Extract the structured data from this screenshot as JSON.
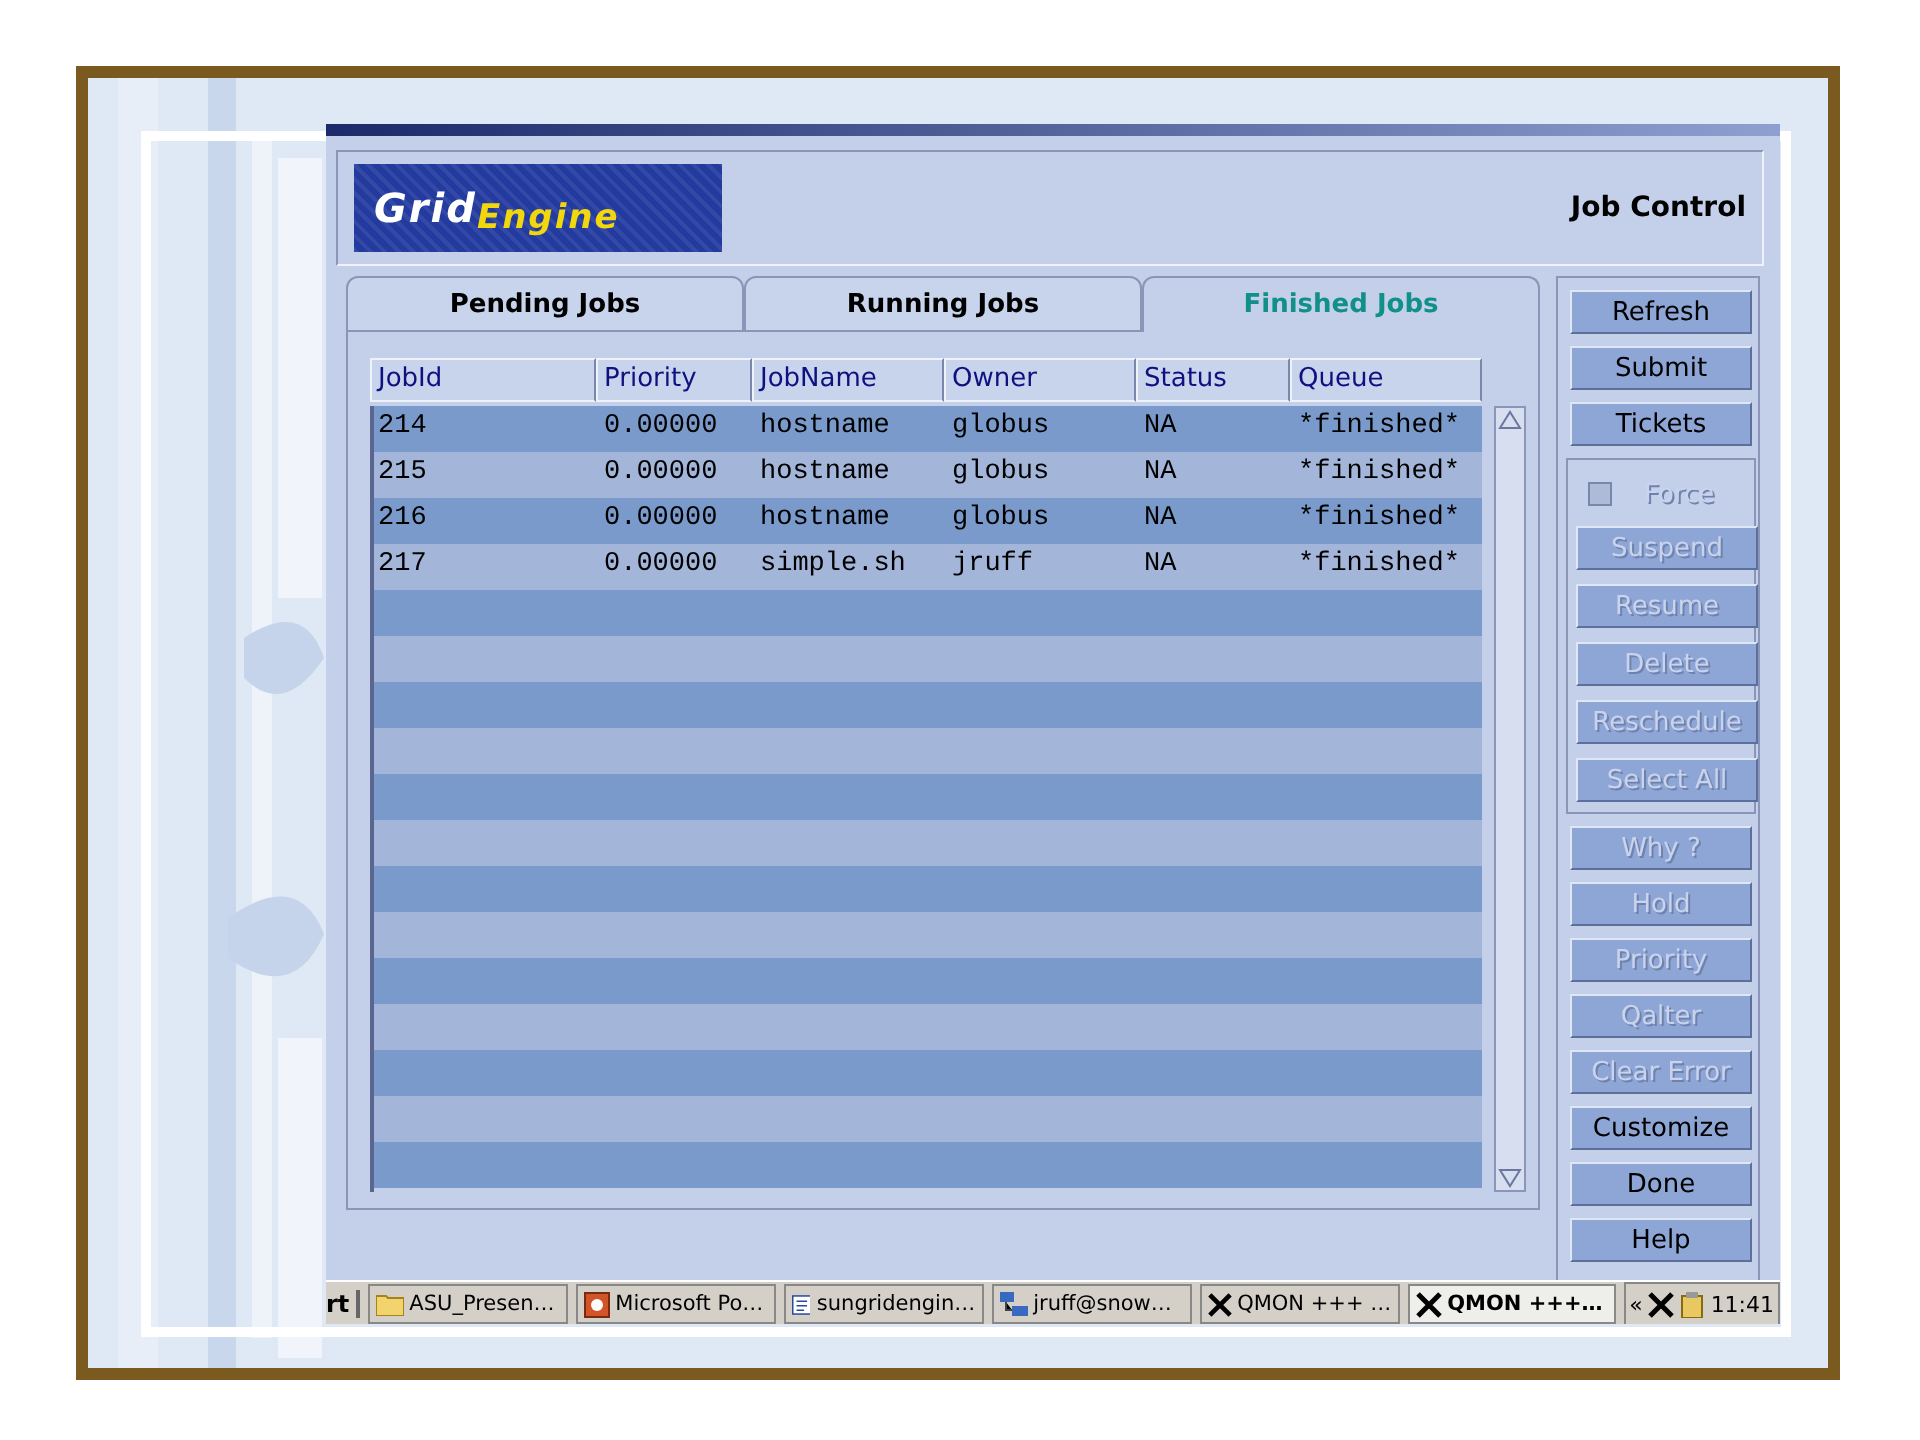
{
  "logo": {
    "first": "Grid",
    "second": "Engine"
  },
  "header_title": "Job Control",
  "tabs": [
    {
      "label": "Pending Jobs",
      "selected": false
    },
    {
      "label": "Running Jobs",
      "selected": false
    },
    {
      "label": "Finished Jobs",
      "selected": true
    }
  ],
  "table": {
    "columns": [
      "JobId",
      "Priority",
      "JobName",
      "Owner",
      "Status",
      "Queue"
    ],
    "rows": [
      [
        "214",
        "0.00000",
        "hostname",
        "globus",
        "NA",
        "*finished*"
      ],
      [
        "215",
        "0.00000",
        "hostname",
        "globus",
        "NA",
        "*finished*"
      ],
      [
        "216",
        "0.00000",
        "hostname",
        "globus",
        "NA",
        "*finished*"
      ],
      [
        "217",
        "0.00000",
        "simple.sh",
        "jruff",
        "NA",
        "*finished*"
      ]
    ]
  },
  "buttons_top": [
    {
      "label": "Refresh",
      "disabled": false
    },
    {
      "label": "Submit",
      "disabled": false
    },
    {
      "label": "Tickets",
      "disabled": false
    }
  ],
  "job_group": {
    "force": {
      "label": "Force",
      "checked": false,
      "disabled": true
    },
    "buttons": [
      {
        "label": "Suspend",
        "disabled": true
      },
      {
        "label": "Resume",
        "disabled": true
      },
      {
        "label": "Delete",
        "disabled": true
      },
      {
        "label": "Reschedule",
        "disabled": true
      },
      {
        "label": "Select All",
        "disabled": true
      }
    ]
  },
  "buttons_bottom": [
    {
      "label": "Why ?",
      "disabled": true
    },
    {
      "label": "Hold",
      "disabled": true
    },
    {
      "label": "Priority",
      "disabled": true
    },
    {
      "label": "Qalter",
      "disabled": true
    },
    {
      "label": "Clear Error",
      "disabled": true
    },
    {
      "label": "Customize",
      "disabled": false
    },
    {
      "label": "Done",
      "disabled": false
    },
    {
      "label": "Help",
      "disabled": false
    }
  ],
  "taskbar": {
    "start": "rt",
    "items": [
      {
        "label": "ASU_Presen…",
        "kind": "folder",
        "selected": false
      },
      {
        "label": "Microsoft Po…",
        "kind": "slides",
        "selected": false
      },
      {
        "label": "sungridengin…",
        "kind": "doc",
        "selected": false
      },
      {
        "label": "jruff@snow…",
        "kind": "network",
        "selected": false
      },
      {
        "label": "QMON +++ …",
        "kind": "x",
        "selected": false
      },
      {
        "label": "QMON +++…",
        "kind": "x",
        "selected": true
      }
    ],
    "tray_chevron": "«",
    "clock": "11:41"
  }
}
